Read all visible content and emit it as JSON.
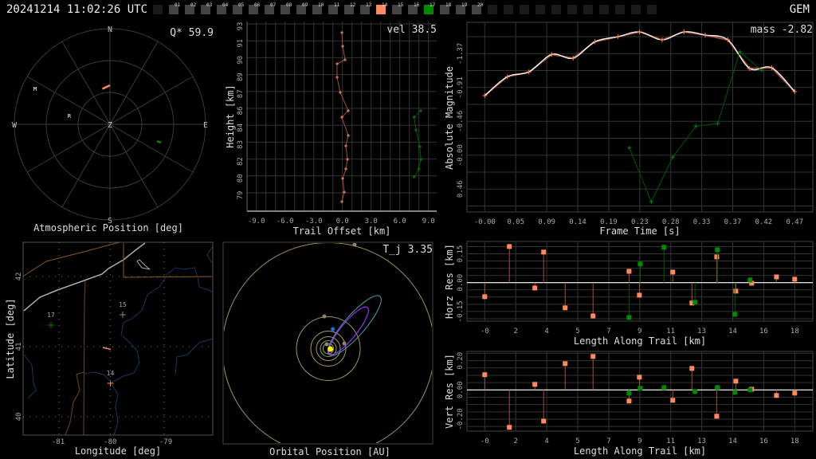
{
  "header": {
    "datetime": "20241214 11:02:26 UTC",
    "shower": "GEM",
    "stations": [
      {
        "label": "",
        "state": "empty"
      },
      {
        "label": "01",
        "state": "idle"
      },
      {
        "label": "02",
        "state": "idle"
      },
      {
        "label": "03",
        "state": "idle"
      },
      {
        "label": "04",
        "state": "idle"
      },
      {
        "label": "05",
        "state": "idle"
      },
      {
        "label": "06",
        "state": "idle"
      },
      {
        "label": "07",
        "state": "idle"
      },
      {
        "label": "08",
        "state": "idle"
      },
      {
        "label": "09",
        "state": "idle"
      },
      {
        "label": "10",
        "state": "idle"
      },
      {
        "label": "11",
        "state": "idle"
      },
      {
        "label": "12",
        "state": "idle"
      },
      {
        "label": "13",
        "state": "idle"
      },
      {
        "label": "14",
        "state": "orange"
      },
      {
        "label": "15",
        "state": "idle"
      },
      {
        "label": "16",
        "state": "idle"
      },
      {
        "label": "17",
        "state": "green"
      },
      {
        "label": "18",
        "state": "idle"
      },
      {
        "label": "19",
        "state": "idle"
      },
      {
        "label": "20",
        "state": "idle"
      },
      {
        "label": "",
        "state": "empty"
      },
      {
        "label": "",
        "state": "empty"
      },
      {
        "label": "",
        "state": "empty"
      },
      {
        "label": "",
        "state": "empty"
      },
      {
        "label": "",
        "state": "empty"
      },
      {
        "label": "",
        "state": "empty"
      },
      {
        "label": "",
        "state": "empty"
      },
      {
        "label": "",
        "state": "empty"
      },
      {
        "label": "",
        "state": "empty"
      },
      {
        "label": "",
        "state": "empty"
      },
      {
        "label": "",
        "state": "empty"
      }
    ]
  },
  "colors": {
    "orange": "#ff8a5c",
    "orange_dark": "#a0503a",
    "green": "#008a00",
    "green_dark": "#005a00",
    "grid": "#333333",
    "tick": "#aaaaaa",
    "empty": "#1a1a1a",
    "idle": "#444444"
  },
  "polar": {
    "title": "Atmospheric Position [deg]",
    "stat_label": "Q* 59.9",
    "compass": {
      "n": "N",
      "s": "S",
      "e": "E",
      "w": "W",
      "z": "Z"
    },
    "markers": [
      {
        "label": "M"
      },
      {
        "label": "R"
      }
    ]
  },
  "height_plot": {
    "stat_label": "vel 38.5",
    "xlabel": "Trail Offset [km]",
    "ylabel": "Height [km]",
    "xticks": [
      "-9.0",
      "-6.0",
      "-3.0",
      "0.0",
      "3.0",
      "6.0",
      "9.0"
    ],
    "xtick_values": [
      -9,
      -6,
      -3,
      0,
      3,
      6,
      9
    ],
    "yticks": [
      "93",
      "91",
      "90",
      "89",
      "87",
      "86",
      "84",
      "83",
      "82",
      "80",
      "79"
    ],
    "orange": [
      [
        -0.06,
        92.28
      ],
      [
        0.03,
        91.16
      ],
      [
        0.28,
        90.04
      ],
      [
        -0.56,
        89.71
      ],
      [
        -0.56,
        88.6
      ],
      [
        -0.23,
        87.35
      ],
      [
        0.61,
        85.84
      ],
      [
        -0.06,
        85.31
      ],
      [
        0.61,
        83.8
      ],
      [
        0.36,
        82.94
      ],
      [
        0.53,
        81.83
      ],
      [
        0.36,
        81.04
      ],
      [
        0.03,
        80.25
      ],
      [
        0.19,
        79.13
      ],
      [
        -0.06,
        78.34
      ]
    ],
    "green": [
      [
        8.2,
        85.84
      ],
      [
        7.5,
        85.31
      ],
      [
        7.7,
        84.26
      ],
      [
        8.1,
        82.88
      ],
      [
        8.2,
        81.83
      ],
      [
        8.0,
        81.04
      ],
      [
        7.5,
        80.38
      ]
    ]
  },
  "mag_plot": {
    "stat_label": "mass -2.82",
    "xlabel": "Frame Time [s]",
    "ylabel": "Absolute Magnitude",
    "xticks": [
      "-0.00",
      "0.05",
      "0.09",
      "0.14",
      "0.19",
      "0.23",
      "0.28",
      "0.33",
      "0.37",
      "0.42",
      "0.47"
    ],
    "yticks": [
      "-1.37",
      "-0.91",
      "-0.46",
      "-0.00",
      "0.46"
    ],
    "orange": [
      [
        0,
        -0.803
      ],
      [
        0.0343,
        -1.058
      ],
      [
        0.067,
        -1.122
      ],
      [
        0.1015,
        -1.359
      ],
      [
        0.1341,
        -1.309
      ],
      [
        0.1672,
        -1.531
      ],
      [
        0.2022,
        -1.599
      ],
      [
        0.2348,
        -1.664
      ],
      [
        0.2689,
        -1.556
      ],
      [
        0.302,
        -1.664
      ],
      [
        0.3343,
        -1.621
      ],
      [
        0.3686,
        -1.556
      ],
      [
        0.4016,
        -1.169
      ],
      [
        0.435,
        -1.18
      ],
      [
        0.47,
        -0.857
      ]
    ],
    "green": [
      [
        0.2192,
        -0.1
      ],
      [
        0.2525,
        0.632
      ],
      [
        0.2851,
        0.029
      ],
      [
        0.3202,
        -0.391
      ],
      [
        0.3532,
        -0.426
      ],
      [
        0.3866,
        -1.395
      ],
      [
        0.4201,
        -1.144
      ]
    ]
  },
  "map_plot": {
    "xlabel": "Longitude [deg]",
    "ylabel": "Latitude [deg]",
    "xticks": [
      "-81",
      "-80",
      "-79"
    ],
    "yticks": [
      "42",
      "41",
      "40"
    ],
    "stations": [
      {
        "label": "17",
        "color": "#008a00"
      },
      {
        "label": "15",
        "color": "#888888"
      },
      {
        "label": "14",
        "color": "#ff8a5c"
      }
    ]
  },
  "orbit_plot": {
    "title": "Orbital Position [AU]",
    "stat_label": "T_j 3.35"
  },
  "horz_res": {
    "ylabel": "Horz Res [km]",
    "xlabel": "Length Along Trail [km]",
    "xticks": [
      "-0",
      "2",
      "4",
      "5",
      "7",
      "9",
      "11",
      "13",
      "14",
      "16",
      "18"
    ],
    "yticks": [
      "0.15",
      "0.00",
      "-0.15"
    ],
    "ytick_values": [
      0.15,
      0,
      -0.15
    ],
    "orange": [
      [
        0,
        -0.073
      ],
      [
        1.43,
        0.188
      ],
      [
        2.91,
        -0.028
      ],
      [
        3.42,
        0.159
      ],
      [
        4.67,
        -0.131
      ],
      [
        6.29,
        -0.173
      ],
      [
        8.38,
        0.059
      ],
      [
        8.98,
        -0.065
      ],
      [
        10.92,
        0.055
      ],
      [
        12.03,
        -0.106
      ],
      [
        13.47,
        0.134
      ],
      [
        14.58,
        -0.044
      ],
      [
        15.5,
        -0.003
      ],
      [
        16.94,
        0.03
      ],
      [
        18,
        0.018
      ]
    ],
    "green": [
      [
        8.38,
        -0.181
      ],
      [
        9.03,
        0.097
      ],
      [
        10.41,
        0.184
      ],
      [
        12.21,
        -0.102
      ],
      [
        13.51,
        0.171
      ],
      [
        14.53,
        -0.165
      ],
      [
        15.41,
        0.014
      ]
    ]
  },
  "vert_res": {
    "ylabel": "Vert Res [km]",
    "xlabel": "Length Along Trail [km]",
    "xticks": [
      "-0",
      "2",
      "4",
      "5",
      "7",
      "9",
      "11",
      "13",
      "14",
      "16",
      "18"
    ],
    "yticks": [
      "0.20",
      "0.00",
      "-0.20"
    ],
    "ytick_values": [
      0.2,
      0,
      -0.2
    ],
    "orange": [
      [
        0,
        0.104
      ],
      [
        1.43,
        -0.256
      ],
      [
        2.91,
        0.038
      ],
      [
        3.42,
        -0.213
      ],
      [
        4.67,
        0.18
      ],
      [
        6.29,
        0.229
      ],
      [
        8.38,
        -0.076
      ],
      [
        8.98,
        0.087
      ],
      [
        10.92,
        -0.071
      ],
      [
        12.03,
        0.147
      ],
      [
        13.47,
        -0.18
      ],
      [
        14.58,
        0.06
      ],
      [
        15.5,
        0.005
      ],
      [
        16.94,
        -0.038
      ],
      [
        18,
        -0.022
      ]
    ],
    "green": [
      [
        8.38,
        -0.022
      ],
      [
        9.03,
        0.011
      ],
      [
        10.41,
        0.016
      ],
      [
        12.21,
        -0.011
      ],
      [
        13.51,
        0.016
      ],
      [
        14.53,
        -0.016
      ],
      [
        15.41,
        0.0
      ]
    ]
  }
}
